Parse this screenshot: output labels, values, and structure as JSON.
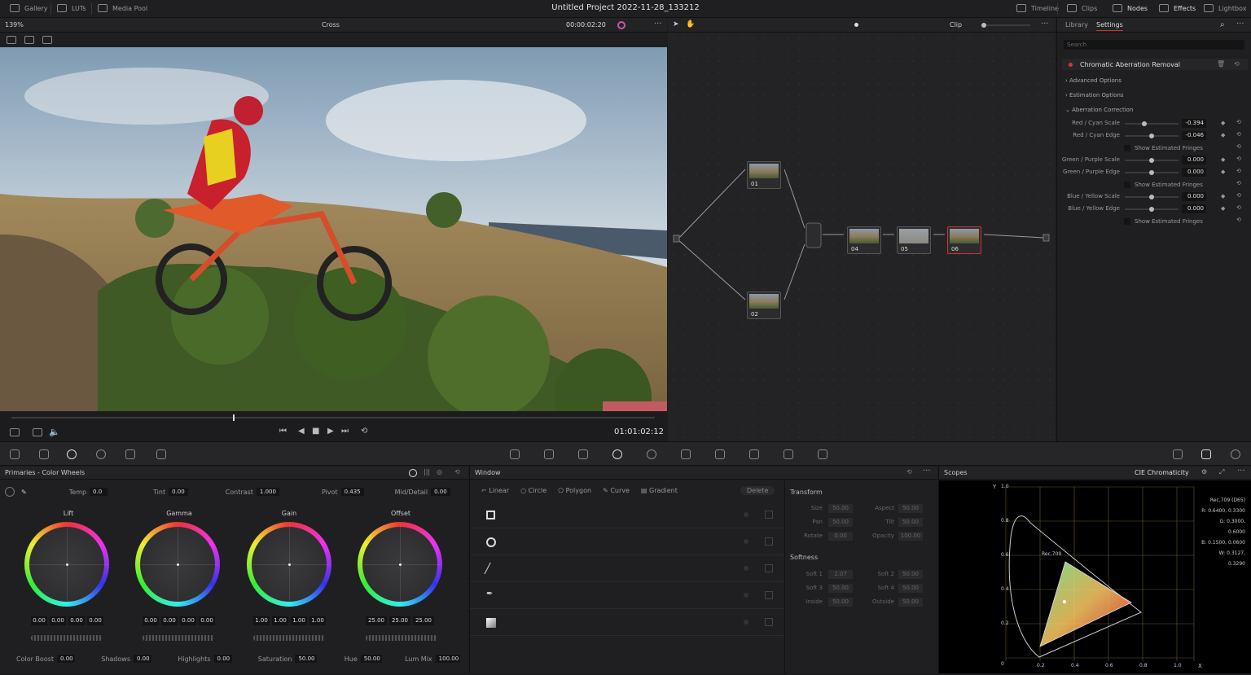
{
  "topbar": {
    "gallery": "Gallery",
    "luts": "LUTs",
    "media_pool": "Media Pool",
    "project_title": "Untitled Project 2022-11-28_133212",
    "timeline": "Timeline",
    "clips": "Clips",
    "nodes": "Nodes",
    "effects": "Effects",
    "lightbox": "Lightbox"
  },
  "viewer": {
    "zoom": "139%",
    "wipe_mode": "Cross",
    "timecode_top": "00:00:02:20",
    "timecode": "01:01:02:12"
  },
  "node_editor": {
    "mode": "Clip",
    "nodes": [
      {
        "label": "01"
      },
      {
        "label": "02"
      },
      {
        "label": "04"
      },
      {
        "label": "05"
      },
      {
        "label": "06"
      }
    ]
  },
  "settings": {
    "tab_library": "Library",
    "tab_settings": "Settings",
    "search_placeholder": "Search",
    "effect_name": "Chromatic Aberration Removal",
    "advanced": "Advanced Options",
    "estimation": "Estimation Options",
    "correction": "Aberration Correction",
    "rows": [
      {
        "label": "Red / Cyan Scale",
        "value": "-0.394",
        "level": 0.35
      },
      {
        "label": "Red / Cyan Edge",
        "value": "-0.046",
        "level": 0.48
      }
    ],
    "rows2": [
      {
        "label": "Green / Purple Scale",
        "value": "0.000",
        "level": 0.5
      },
      {
        "label": "Green / Purple Edge",
        "value": "0.000",
        "level": 0.5
      }
    ],
    "rows3": [
      {
        "label": "Blue / Yellow Scale",
        "value": "0.000",
        "level": 0.5
      },
      {
        "label": "Blue / Yellow Edge",
        "value": "0.000",
        "level": 0.5
      }
    ],
    "show_fringes": "Show Estimated Fringes"
  },
  "primaries": {
    "title": "Primaries - Color Wheels",
    "temp_label": "Temp",
    "temp": "0.0",
    "tint_label": "Tint",
    "tint": "0.00",
    "contrast_label": "Contrast",
    "contrast": "1.000",
    "pivot_label": "Pivot",
    "pivot": "0.435",
    "md_label": "Mid/Detail",
    "md": "0.00",
    "wheels": [
      {
        "name": "Lift",
        "vals": [
          "0.00",
          "0.00",
          "0.00",
          "0.00"
        ]
      },
      {
        "name": "Gamma",
        "vals": [
          "0.00",
          "0.00",
          "0.00",
          "0.00"
        ]
      },
      {
        "name": "Gain",
        "vals": [
          "1.00",
          "1.00",
          "1.00",
          "1.00"
        ]
      },
      {
        "name": "Offset",
        "vals": [
          "25.00",
          "25.00",
          "25.00"
        ]
      }
    ],
    "cb_label": "Color Boost",
    "cb": "0.00",
    "sh_label": "Shadows",
    "sh": "0.00",
    "hi_label": "Highlights",
    "hi": "0.00",
    "sat_label": "Saturation",
    "sat": "50.00",
    "hue_label": "Hue",
    "hue": "50.00",
    "lm_label": "Lum Mix",
    "lm": "100.00"
  },
  "window": {
    "title": "Window",
    "linear": "Linear",
    "circle": "Circle",
    "polygon": "Polygon",
    "curve": "Curve",
    "gradient": "Gradient",
    "delete": "Delete",
    "transform": "Transform",
    "softness": "Softness",
    "tf": [
      {
        "l": "Size",
        "v": "50.00"
      },
      {
        "l": "Aspect",
        "v": "50.00"
      },
      {
        "l": "Pan",
        "v": "50.00"
      },
      {
        "l": "Tilt",
        "v": "50.00"
      },
      {
        "l": "Rotate",
        "v": "0.00"
      },
      {
        "l": "Opacity",
        "v": "100.00"
      }
    ],
    "sf": [
      {
        "l": "Soft 1",
        "v": "2.07"
      },
      {
        "l": "Soft 2",
        "v": "50.00"
      },
      {
        "l": "Soft 3",
        "v": "50.00"
      },
      {
        "l": "Soft 4",
        "v": "50.00"
      },
      {
        "l": "Inside",
        "v": "50.00"
      },
      {
        "l": "Outside",
        "v": "50.00"
      }
    ]
  },
  "scopes": {
    "title": "Scopes",
    "mode": "CIE Chromaticity",
    "gamut": "Rec.709",
    "info": [
      "Rec.709 (D65)",
      "R: 0.6400, 0.3300",
      "G: 0.3000, 0.6000",
      "B: 0.1500, 0.0600",
      "W: 0.3127, 0.3290"
    ],
    "ylabels": [
      "1.0",
      "0.8",
      "0.6",
      "0.4",
      "0.2",
      "0"
    ],
    "xlabels": [
      "0.2",
      "0.4",
      "0.6",
      "0.8",
      "1.0"
    ],
    "y_axis": "Y",
    "x_axis": "X"
  }
}
